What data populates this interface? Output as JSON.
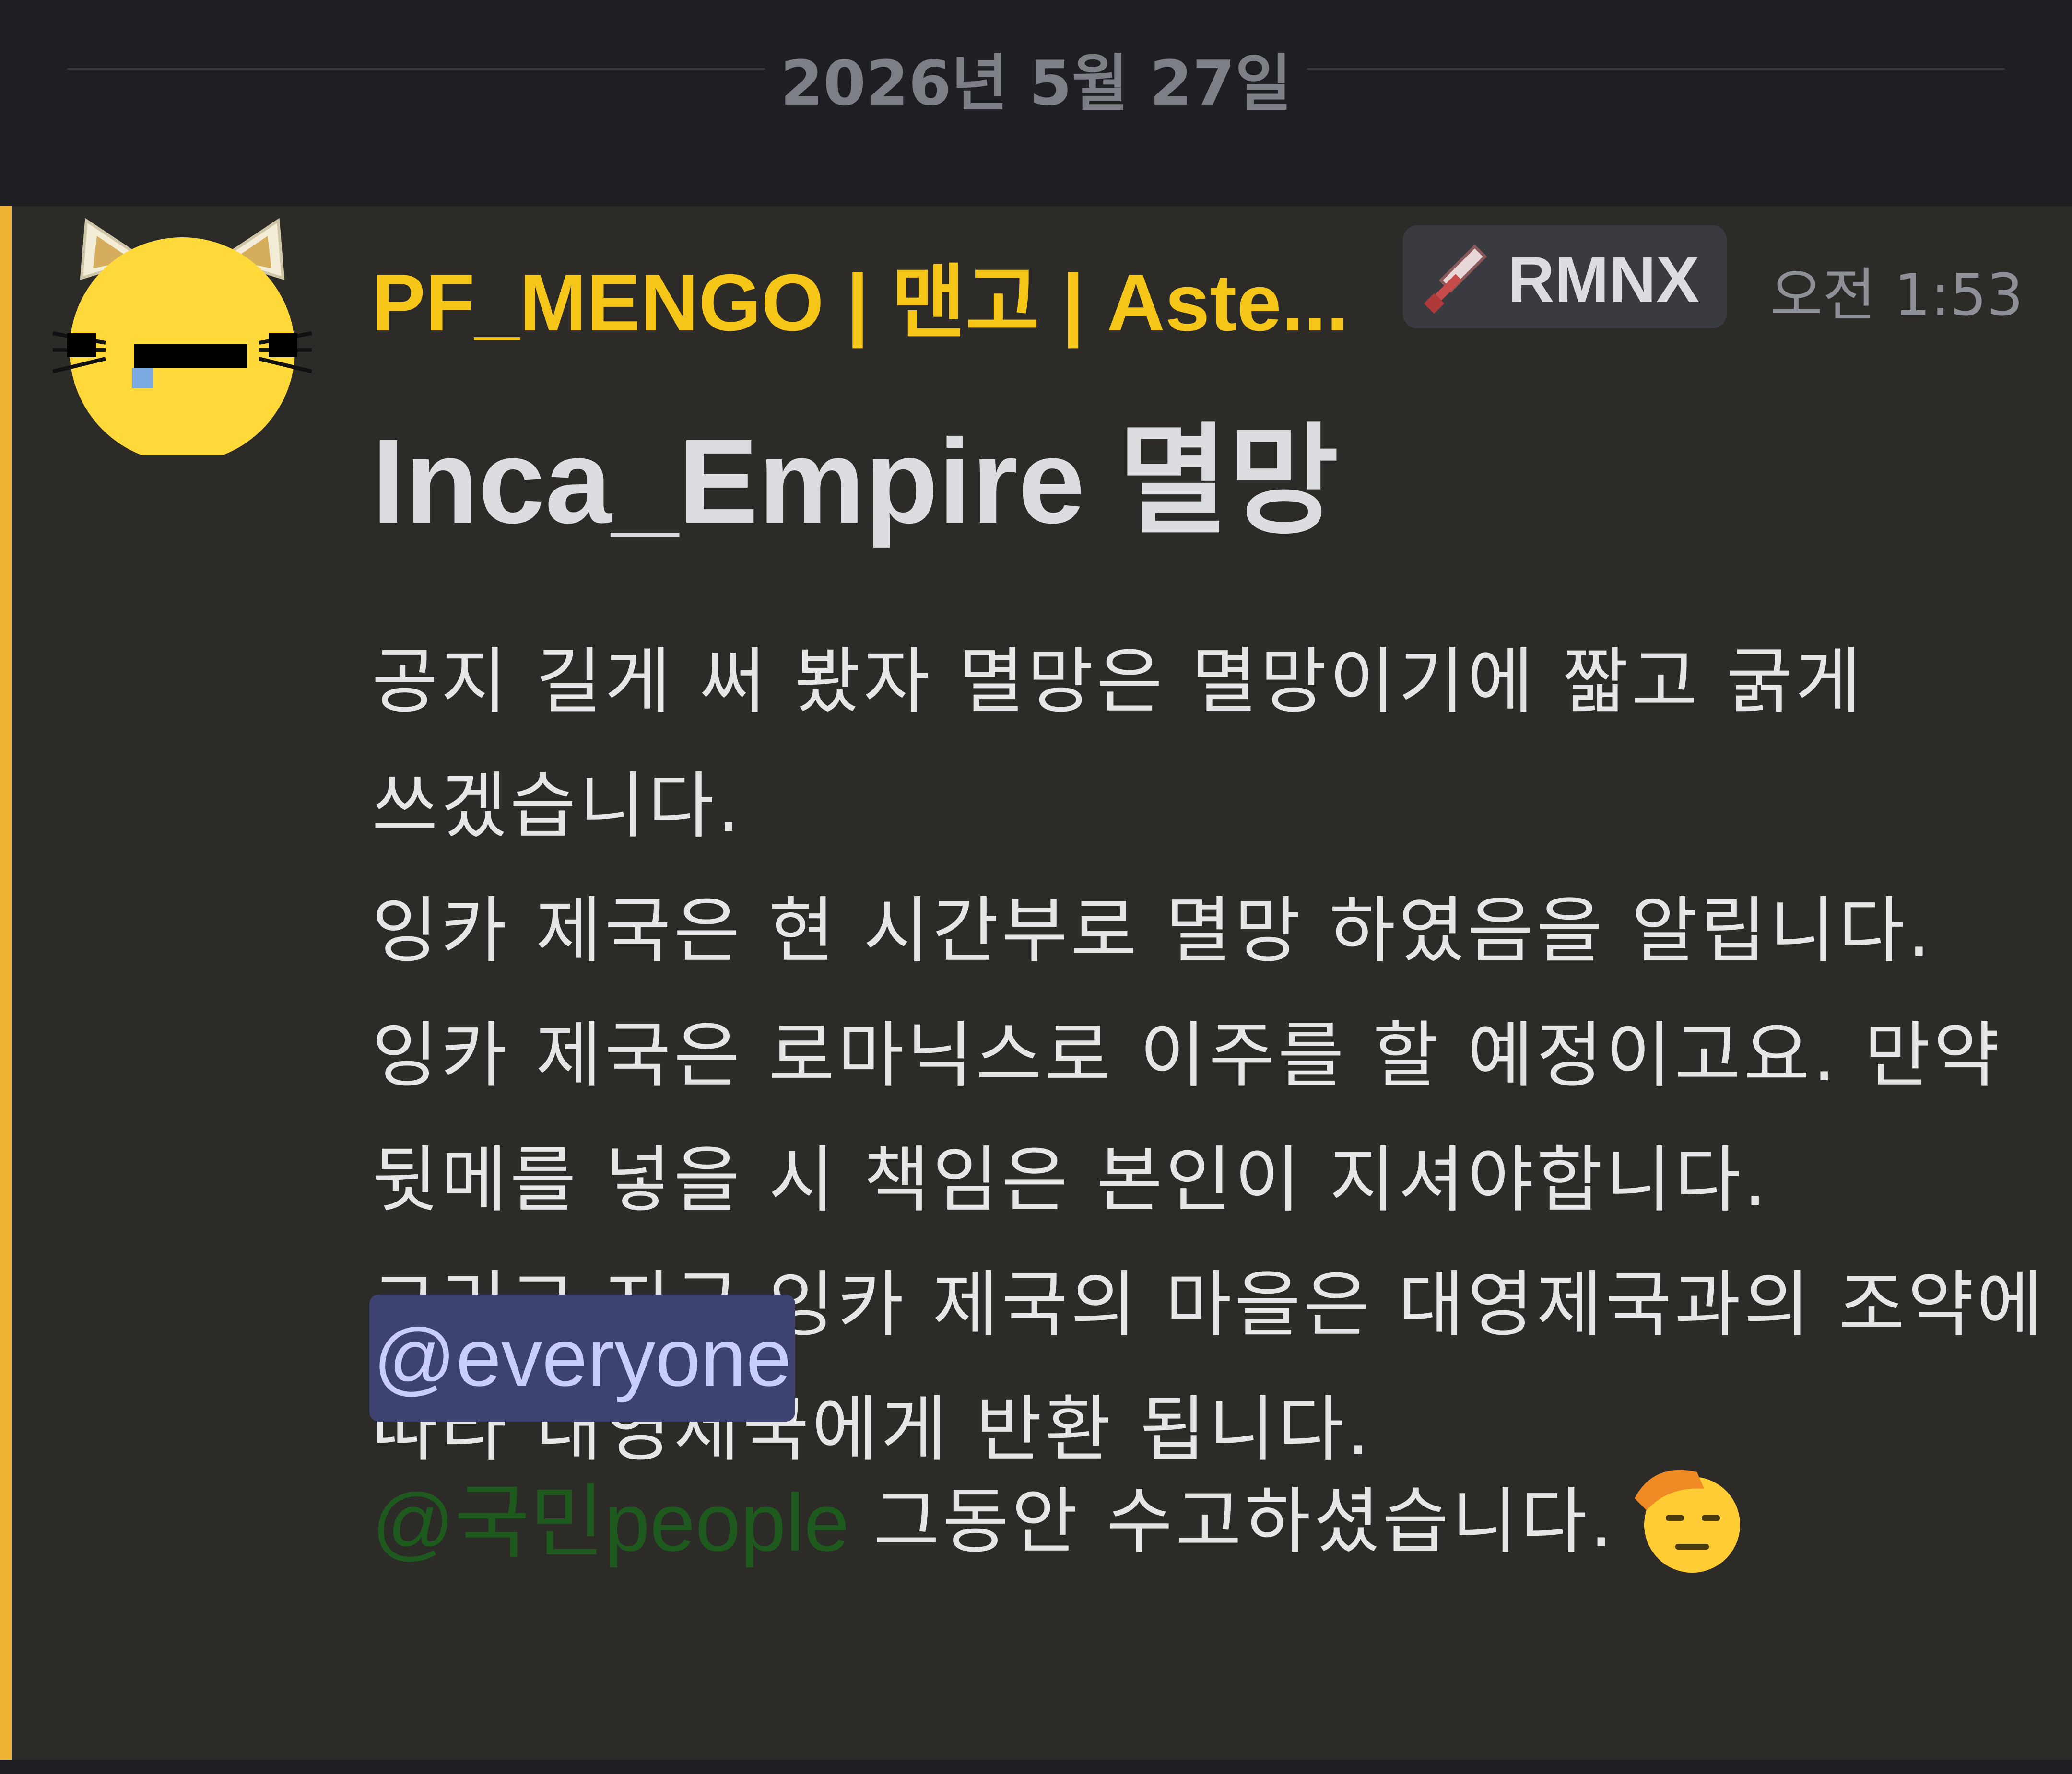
{
  "date_divider": {
    "label": "2026년 5월 27일"
  },
  "message": {
    "author": {
      "username": "PF_MENGO | 맨고 | Aste...",
      "avatar": "yellow-cat-face-icon",
      "username_color": "#f5c518"
    },
    "tag": {
      "icon": "sword-icon",
      "label": "RMNX"
    },
    "timestamp": "오전 1:53",
    "heading": "Inca_Empire 멸망",
    "body_lines": [
      "공지 길게 써 봤자 멸망은 멸망이기에 짧고 굵게",
      "쓰겠습니다.",
      "잉카 제국은 현 시간부로 멸망 하였음을 알립니다.",
      "잉카 제국은 로마닉스로 이주를 할 예정이고요.  만약",
      "뒷메를 넣을 시 책임은 본인이 지셔야합니다.",
      "그리고 지금 잉카 제국의 마을은 대영제국과의 조약에",
      "따라 대영제국에게 반환 됩니다."
    ],
    "mentions": {
      "everyone": "@everyone",
      "role": "@국민people"
    },
    "closing_text": "그동안 수고하셨습니다.",
    "closing_emoji": "saluting-face-icon",
    "colors": {
      "mention_bar": "#f0b232",
      "everyone_bg": "#3e4270",
      "everyone_text": "#c9cdfb",
      "role_text": "#1e5a1e"
    }
  }
}
